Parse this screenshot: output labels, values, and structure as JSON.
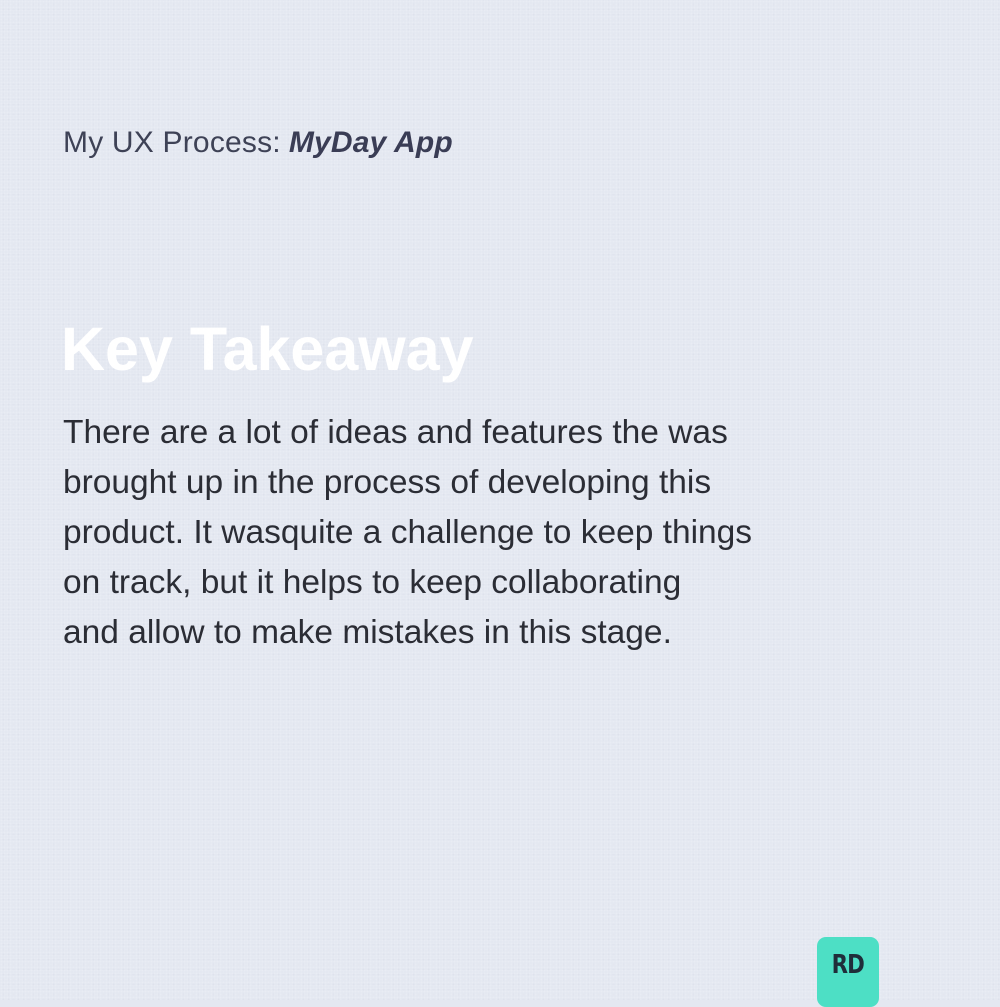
{
  "header": {
    "prefix": "My UX Process:",
    "project": "MyDay App"
  },
  "section": {
    "title": "Key Takeaway",
    "body_lines": [
      "There are a lot of ideas and features the was",
      "brought up in the process of developing this",
      "product. It wasquite a challenge to keep things",
      "on track, but it helps to keep collaborating",
      "and allow to make mistakes in this stage."
    ]
  },
  "badge": {
    "text": "RD",
    "color": "#4ddfc5"
  },
  "colors": {
    "background": "#e4e8f1",
    "heading": "#ffffff",
    "body_text": "#2b2d35"
  }
}
